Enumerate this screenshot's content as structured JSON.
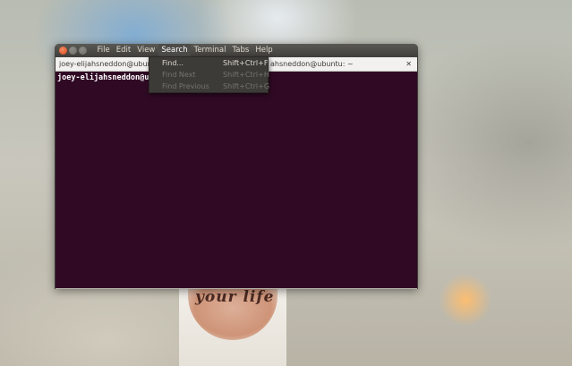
{
  "window": {
    "menu": [
      "File",
      "Edit",
      "View",
      "Search",
      "Terminal",
      "Tabs",
      "Help"
    ],
    "active_menu": "Search"
  },
  "tabs": [
    {
      "title": "joey-elijahsneddon@ubuntu"
    },
    {
      "title": "ahsneddon@ubuntu: ~"
    }
  ],
  "terminal": {
    "prompt": "joey-elijahsneddon@ubuntu",
    "background": "#300a24"
  },
  "search_menu": {
    "items": [
      {
        "label": "Find...",
        "shortcut": "Shift+Ctrl+F",
        "enabled": true
      },
      {
        "label": "Find Next",
        "shortcut": "Shift+Ctrl+H",
        "enabled": false
      },
      {
        "label": "Find Previous",
        "shortcut": "Shift+Ctrl+G",
        "enabled": false
      }
    ]
  },
  "wallpaper": {
    "cup_text": "your life"
  }
}
